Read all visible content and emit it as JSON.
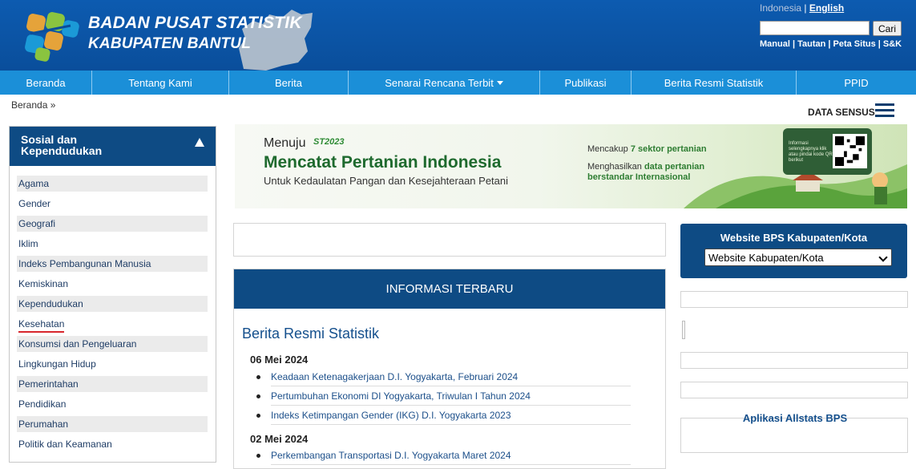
{
  "header": {
    "title_line1": "BADAN PUSAT STATISTIK",
    "title_line2": "KABUPATEN BANTUL",
    "lang_indonesia": "Indonesia",
    "lang_separator": "|",
    "lang_english": "English",
    "search_button": "Cari",
    "search_value": "",
    "top_links": "Manual | Tautan | Peta Situs | S&K"
  },
  "nav": {
    "items": [
      {
        "label": "Beranda"
      },
      {
        "label": "Tentang Kami"
      },
      {
        "label": "Berita"
      },
      {
        "label": "Senarai Rencana Terbit"
      },
      {
        "label": "Publikasi"
      },
      {
        "label": "Berita Resmi Statistik"
      },
      {
        "label": "PPID"
      }
    ]
  },
  "breadcrumb": "Beranda »",
  "data_sensus": "DATA SENSUS",
  "sidebar": {
    "title": "Sosial dan Kependudukan",
    "items": [
      {
        "label": "Agama"
      },
      {
        "label": "Gender"
      },
      {
        "label": "Geografi"
      },
      {
        "label": "Iklim"
      },
      {
        "label": "Indeks Pembangunan Manusia"
      },
      {
        "label": "Kemiskinan"
      },
      {
        "label": "Kependudukan"
      },
      {
        "label": "Kesehatan"
      },
      {
        "label": "Konsumsi dan Pengeluaran"
      },
      {
        "label": "Lingkungan Hidup"
      },
      {
        "label": "Pemerintahan"
      },
      {
        "label": "Pendidikan"
      },
      {
        "label": "Perumahan"
      },
      {
        "label": "Politik dan Keamanan"
      }
    ]
  },
  "banner": {
    "menuju": "Menuju",
    "st_logo": "ST2023",
    "title": "Mencatat Pertanian Indonesia",
    "subtitle": "Untuk Kedaulatan Pangan dan Kesejahteraan Petani",
    "right1_prefix": "Mencakup",
    "right1_bold": "7 sektor pertanian",
    "right2_prefix": "Menghasilkan",
    "right2_bold1": "data pertanian",
    "right2_bold2": "berstandar Internasional",
    "qr_text": "Informasi selengkapnya klik atau pindai kode QR berikut"
  },
  "info": {
    "header": "INFORMASI TERBARU",
    "section_title": "Berita Resmi Statistik",
    "groups": [
      {
        "date": "06 Mei 2024",
        "items": [
          "Keadaan Ketenagakerjaan D.I. Yogyakarta, Februari 2024",
          "Pertumbuhan Ekonomi DI Yogyakarta, Triwulan I Tahun 2024",
          "Indeks Ketimpangan Gender (IKG) D.I. Yogyakarta 2023"
        ]
      },
      {
        "date": "02 Mei 2024",
        "items": [
          "Perkembangan Transportasi D.I. Yogyakarta Maret 2024"
        ]
      }
    ]
  },
  "right_panel": {
    "website_title": "Website BPS Kabupaten/Kota",
    "select_value": "Website Kabupaten/Kota",
    "allstats_title": "Aplikasi Allstats BPS"
  },
  "colors": {
    "header_blue": "#0a4e9b",
    "nav_blue": "#1b8fd8",
    "panel_navy": "#0e4b84",
    "link_blue": "#1c4f8a",
    "selected_underline": "#d7262d"
  }
}
